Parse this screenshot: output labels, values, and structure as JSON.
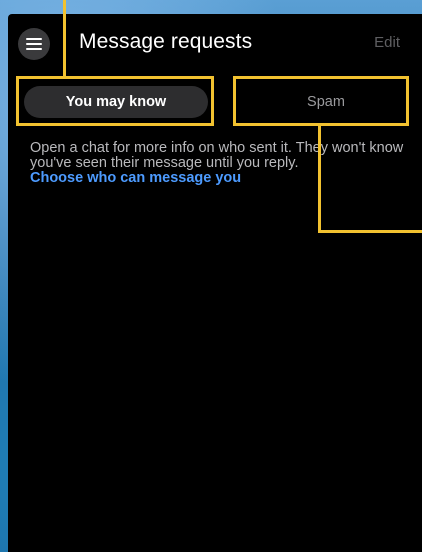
{
  "header": {
    "title": "Message requests",
    "edit_label": "Edit"
  },
  "tabs": [
    {
      "label": "You may know",
      "selected": true
    },
    {
      "label": "Spam",
      "selected": false
    }
  ],
  "info": {
    "text": "Open a chat for more info on who sent it. They won't know you've seen their message until you reply.",
    "link": "Choose who can message you"
  },
  "icons": {
    "menu": "hamburger-menu-icon"
  },
  "colors": {
    "background": "#000000",
    "link": "#4d9bff",
    "selected_tab_bg": "#2d2d2f",
    "annotation": "#f2c230"
  }
}
